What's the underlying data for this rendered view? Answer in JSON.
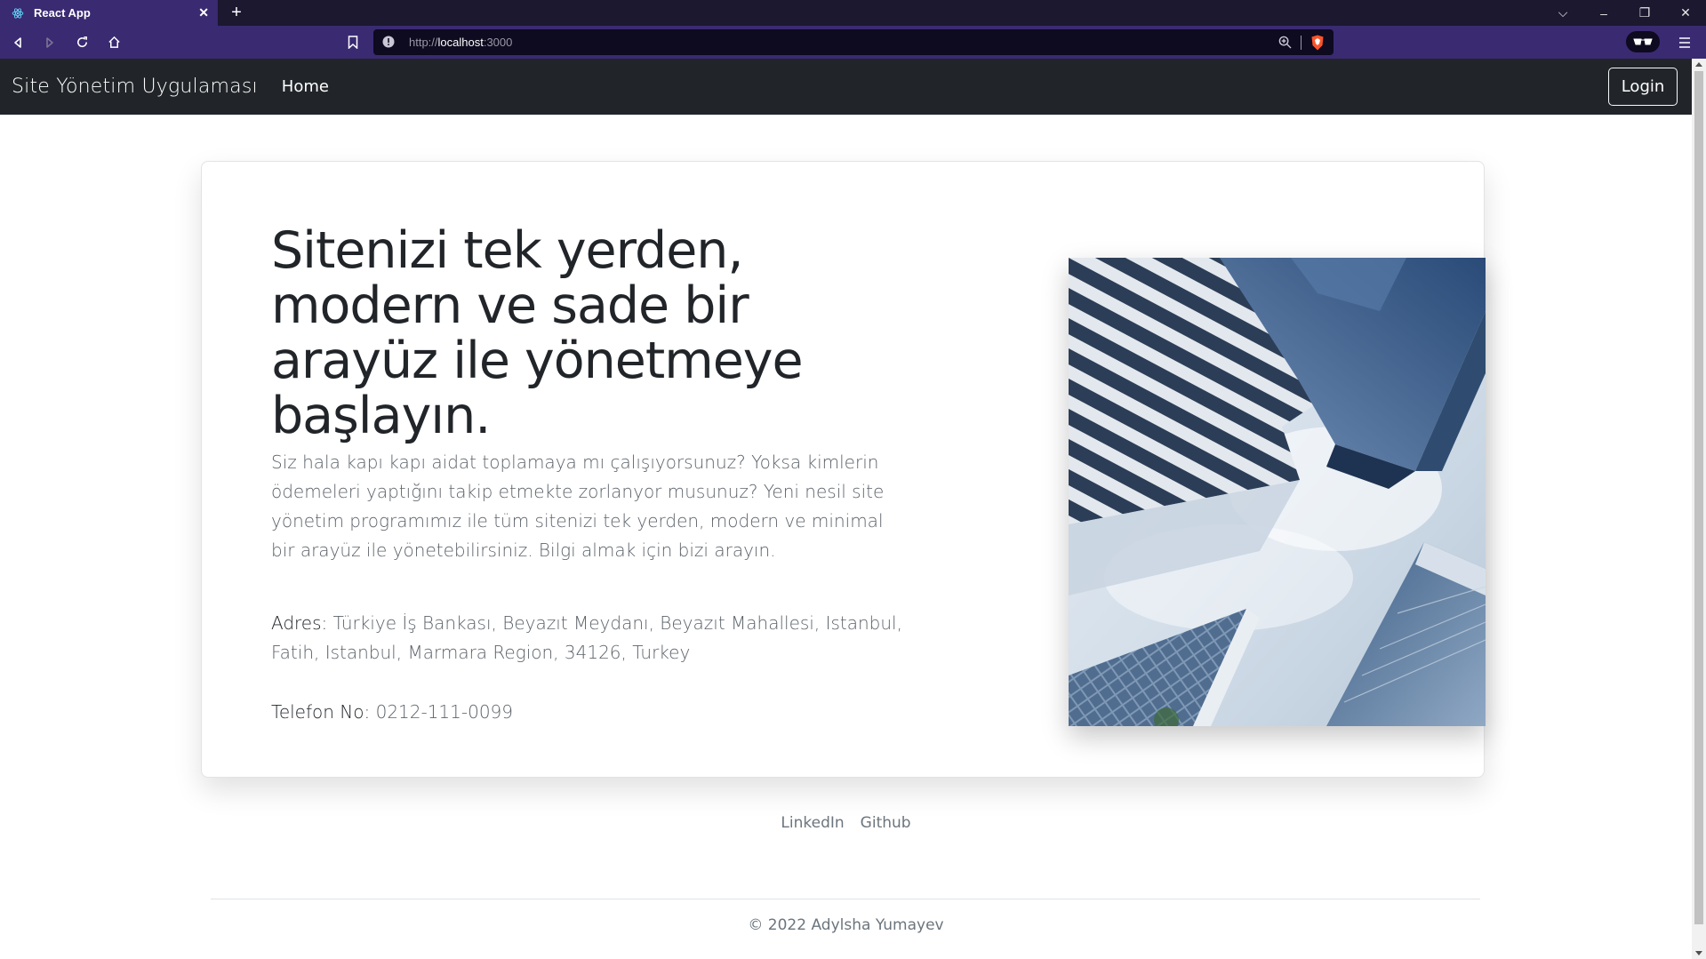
{
  "browser": {
    "tab_title": "React App",
    "new_tab_symbol": "+",
    "tab_close_symbol": "✕",
    "url_scheme": "http://",
    "url_host": "localhost",
    "url_port": ":3000",
    "window_controls": {
      "dropdown": "⌵",
      "minimize": "–",
      "restore": "❐",
      "close": "✕"
    }
  },
  "navbar": {
    "brand": "Site Yönetim Uygulaması",
    "home_link": "Home",
    "login_button": "Login"
  },
  "hero": {
    "title": "Sitenizi tek yerden, modern ve sade bir arayüz ile yönetmeye başlayın.",
    "description": "Siz hala kapı kapı aidat toplamaya mı çalışıyorsunuz? Yoksa kimlerin ödemeleri yaptığını takip etmekte zorlanyor musunuz? Yeni nesil site yönetim programımız ile tüm sitenizi tek yerden, modern ve minimal bir arayüz ile yönetebilirsiniz. Bilgi almak için bizi arayın.",
    "address_label": "Adres:",
    "address_value": "Türkiye İş Bankası, Beyazıt Meydanı, Beyazıt Mahallesi, Istanbul, Fatih, Istanbul, Marmara Region, 34126, Turkey",
    "phone_label": "Telefon No:",
    "phone_value": "0212-111-0099"
  },
  "footer": {
    "links": [
      "LinkedIn",
      "Github"
    ],
    "copyright": "© 2022 Adylsha Yumayev"
  },
  "colors": {
    "navbar_bg": "#212529",
    "browser_toolbar": "#3a2a72",
    "browser_tabbar": "#1b1830",
    "text_muted": "#6c757d"
  }
}
